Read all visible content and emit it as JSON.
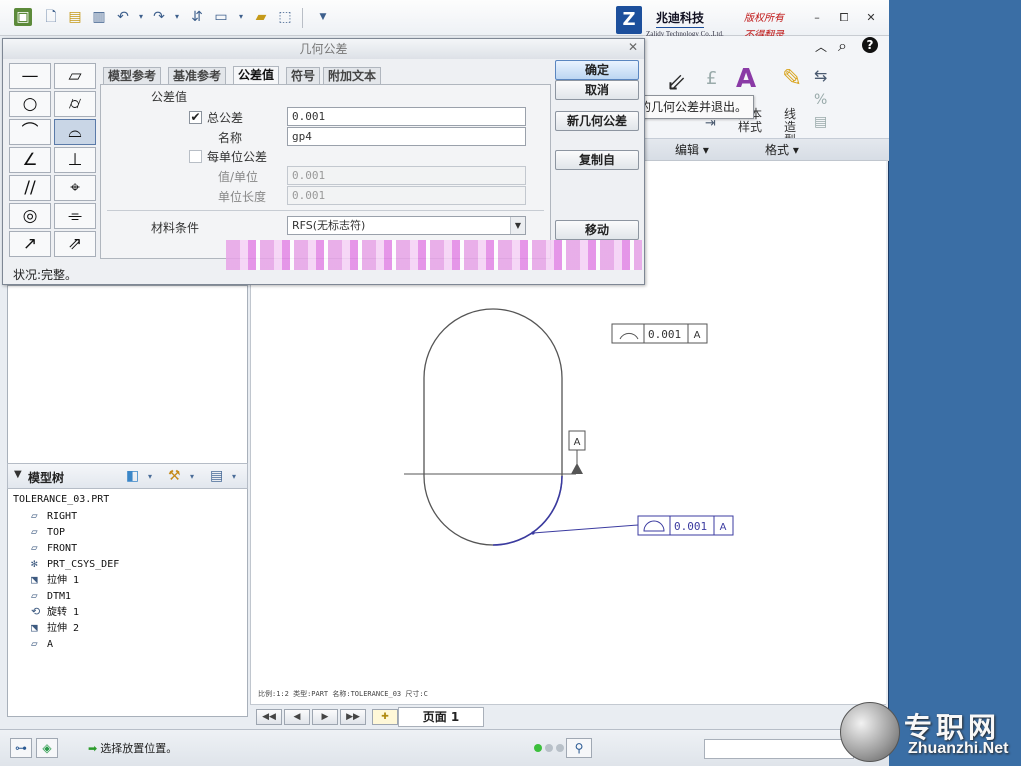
{
  "brand": {
    "logo_letter": "Z",
    "name": "兆迪科技",
    "en": "Zalidy Technology Co.,Ltd.",
    "rights1": "版权所有",
    "rights2": "不得翻录"
  },
  "window_buttons": {
    "minimize": "–",
    "restore": "⧠",
    "close": "✕"
  },
  "ribbon": {
    "labels": {
      "text_style": "文本\n样式",
      "line_style": "线造型"
    },
    "groups": {
      "edit": "编辑 ▾",
      "format": "格式 ▾"
    }
  },
  "tooltip": "接受创建的几何公差并退出。",
  "dialog": {
    "title": "几何公差",
    "close": "✕",
    "tabs": [
      "模型参考",
      "基准参考",
      "公差值",
      "符号",
      "附加文本"
    ],
    "active_tab": "公差值",
    "section_title": "公差值",
    "total_tol_label": "总公差",
    "total_tol_checked": true,
    "total_tol_value": "0.001",
    "name_label": "名称",
    "name_value": "gp4",
    "per_unit_label": "每单位公差",
    "per_unit_checked": false,
    "value_per_unit_label": "值/单位",
    "value_per_unit": "0.001",
    "unit_length_label": "单位长度",
    "unit_length": "0.001",
    "material_label": "材料条件",
    "material_value": "RFS(无标志符)",
    "buttons": {
      "ok": "确定",
      "cancel": "取消",
      "new": "新几何公差",
      "copy": "复制自",
      "move": "移动"
    },
    "status": "状况:完整。",
    "symbols": [
      {
        "name": "straightness-icon",
        "glyph": "—"
      },
      {
        "name": "flatness-icon",
        "glyph": "▱"
      },
      {
        "name": "circularity-icon",
        "glyph": "○"
      },
      {
        "name": "cylindricity-icon",
        "glyph": "⌭"
      },
      {
        "name": "line-profile-icon",
        "glyph": "⌒"
      },
      {
        "name": "surface-profile-icon",
        "glyph": "⌓"
      },
      {
        "name": "angularity-icon",
        "glyph": "∠"
      },
      {
        "name": "perpendicularity-icon",
        "glyph": "⊥"
      },
      {
        "name": "parallelism-icon",
        "glyph": "//"
      },
      {
        "name": "position-icon",
        "glyph": "⌖"
      },
      {
        "name": "concentricity-icon",
        "glyph": "◎"
      },
      {
        "name": "symmetry-icon",
        "glyph": "⌯"
      },
      {
        "name": "circular-runout-icon",
        "glyph": "↗"
      },
      {
        "name": "total-runout-icon",
        "glyph": "⇗"
      }
    ],
    "selected_symbol": 5
  },
  "model_tree": {
    "title": "模型树",
    "items": [
      {
        "icon": "part-icon",
        "label": "TOLERANCE_03.PRT",
        "indent": 0
      },
      {
        "icon": "datum-plane-icon",
        "label": "RIGHT",
        "indent": 1
      },
      {
        "icon": "datum-plane-icon",
        "label": "TOP",
        "indent": 1
      },
      {
        "icon": "datum-plane-icon",
        "label": "FRONT",
        "indent": 1
      },
      {
        "icon": "csys-icon",
        "label": "PRT_CSYS_DEF",
        "indent": 1
      },
      {
        "icon": "extrude-icon",
        "label": "拉伸 1",
        "indent": 1
      },
      {
        "icon": "datum-plane-icon",
        "label": "DTM1",
        "indent": 1
      },
      {
        "icon": "revolve-icon",
        "label": "旋转 1",
        "indent": 1
      },
      {
        "icon": "extrude-icon",
        "label": "拉伸 2",
        "indent": 1
      },
      {
        "icon": "datum-plane-icon",
        "label": "A",
        "indent": 1
      }
    ]
  },
  "drawing": {
    "gtol1": {
      "value": "0.001",
      "datum": "A"
    },
    "gtol2": {
      "value": "0.001",
      "datum": "A"
    },
    "datum_label": "A",
    "info_line": "比例:1:2    类型:PART  名称:TOLERANCE_03  尺寸:C"
  },
  "pager": {
    "page_label": "页面 1"
  },
  "statusbar": {
    "message": "选择放置位置。"
  },
  "watermark": {
    "cn": "专职网",
    "en": "Zhuanzhi.Net"
  },
  "colors": {
    "accent": "#3a6ea5",
    "selection": "#c9d6e6",
    "blur": "#e386e6",
    "rights": "#c01818"
  }
}
